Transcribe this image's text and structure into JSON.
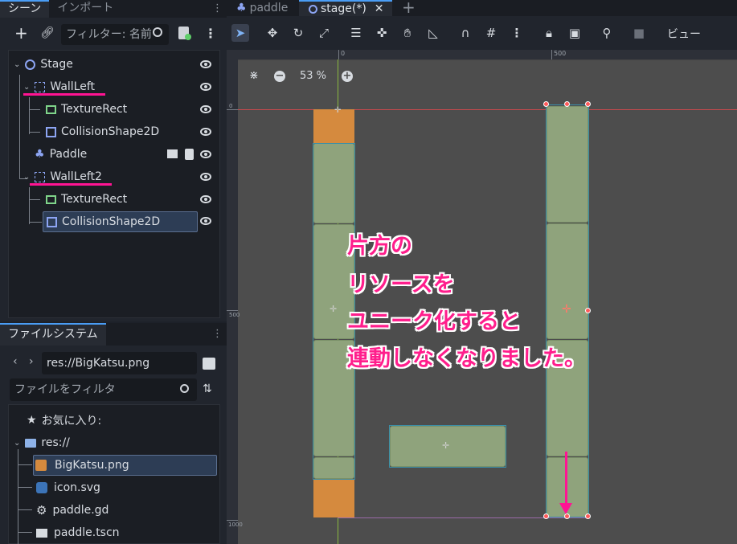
{
  "scene_dock": {
    "tabs": [
      "シーン",
      "インポート"
    ],
    "filter_placeholder": "フィルター: 名前"
  },
  "tree": [
    {
      "label": "Stage",
      "icon": "node2d-icon"
    },
    {
      "label": "WallLeft",
      "icon": "static-body-icon"
    },
    {
      "label": "TextureRect",
      "icon": "texture-rect-icon"
    },
    {
      "label": "CollisionShape2D",
      "icon": "collision-shape-icon"
    },
    {
      "label": "Paddle",
      "icon": "character-body-icon"
    },
    {
      "label": "WallLeft2",
      "icon": "static-body-icon"
    },
    {
      "label": "TextureRect",
      "icon": "texture-rect-icon"
    },
    {
      "label": "CollisionShape2D",
      "icon": "collision-shape-icon"
    }
  ],
  "filesystem": {
    "tab": "ファイルシステム",
    "path": "res://BigKatsu.png",
    "filter_placeholder": "ファイルをフィルタ",
    "items": [
      {
        "label": "お気に入り:",
        "icon": "star-icon"
      },
      {
        "label": "res://",
        "icon": "folder-icon"
      },
      {
        "label": "BigKatsu.png",
        "icon": "image-icon"
      },
      {
        "label": "icon.svg",
        "icon": "svg-icon"
      },
      {
        "label": "paddle.gd",
        "icon": "gear-icon"
      },
      {
        "label": "paddle.tscn",
        "icon": "clapper-icon"
      }
    ]
  },
  "editor_tabs": [
    {
      "label": "paddle"
    },
    {
      "label": "stage(*)"
    }
  ],
  "toolbar": {
    "view_label": "ビュー"
  },
  "viewport": {
    "zoom": "53 %",
    "ruler_h": [
      "0",
      "500"
    ],
    "ruler_v": [
      "0",
      "500",
      "1000"
    ]
  },
  "annotation": {
    "lines": [
      "片方の",
      "リソースを",
      "ユニーク化すると",
      "連動しなくなりました。"
    ],
    "color": "#ff1e8c"
  },
  "colors": {
    "accent": "#4a9df5",
    "selection": "#2d3d55",
    "handle": "#ff5a5a"
  }
}
